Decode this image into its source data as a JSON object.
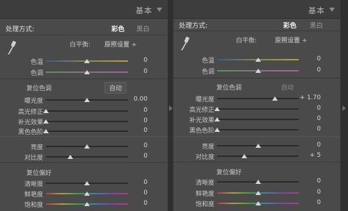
{
  "header": {
    "title": "基本"
  },
  "treatment": {
    "label": "处理方式:",
    "color": "彩色",
    "bw": "黑白"
  },
  "wb": {
    "label": "白平衡:",
    "value": "原照设置 ÷"
  },
  "labels": {
    "temp": "色温",
    "tint": "色调",
    "tone": "复位色调",
    "auto": "自动",
    "exposure": "曝光度",
    "highlight": "高光修正",
    "fill": "补光效果",
    "blacks": "黑色色阶",
    "brightness": "亮度",
    "contrast": "对比度",
    "presence": "复位偏好",
    "clarity": "清晰度",
    "vibrance": "鲜艳度",
    "saturation": "饱和度"
  },
  "left_values": {
    "temp": "0",
    "tint": "0",
    "exposure": "0.00",
    "highlight": "0",
    "fill": "0",
    "blacks": "0",
    "brightness": "0",
    "contrast": "0",
    "clarity": "0",
    "vibrance": "0",
    "saturation": "0"
  },
  "right_values": {
    "temp": "0",
    "tint": "0",
    "exposure": "+ 1.70",
    "highlight": "0",
    "fill": "0",
    "blacks": "0",
    "brightness": "0",
    "contrast": "+ 5",
    "clarity": "0",
    "vibrance": "0",
    "saturation": "0"
  },
  "left_levels": {
    "temp": 0.5,
    "tint": 0.5,
    "exposure": 0.5,
    "highlight": 0.0,
    "fill": 0.0,
    "blacks": 0.0,
    "brightness": 0.5,
    "contrast": 0.3,
    "clarity": 0.5,
    "vibrance": 0.5,
    "saturation": 0.5
  },
  "right_levels": {
    "temp": 0.5,
    "tint": 0.5,
    "exposure": 0.71,
    "highlight": 0.0,
    "fill": 0.0,
    "blacks": 0.0,
    "brightness": 0.5,
    "contrast": 0.33,
    "clarity": 0.5,
    "vibrance": 0.5,
    "saturation": 0.5
  },
  "colors": {
    "panel": "#4a4a4a",
    "header": "#3d3d3d",
    "knob": "#d8d8d8"
  }
}
